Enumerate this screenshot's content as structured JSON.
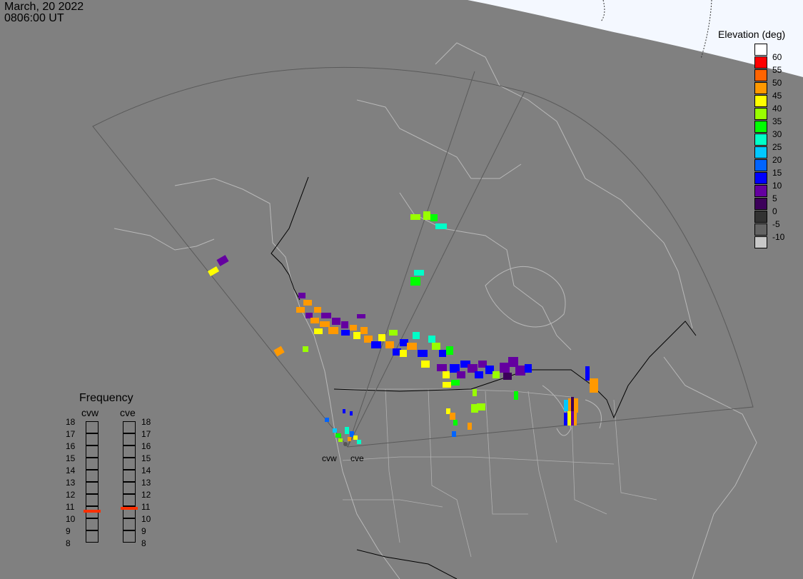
{
  "header": {
    "date": "March, 20 2022",
    "time": "0806:00 UT"
  },
  "legend": {
    "title": "Elevation (deg)",
    "entries": [
      {
        "label": "60",
        "color": "#ffffff"
      },
      {
        "label": "55",
        "color": "#ff0000"
      },
      {
        "label": "50",
        "color": "#ff6400"
      },
      {
        "label": "45",
        "color": "#ff9900"
      },
      {
        "label": "40",
        "color": "#ffff00"
      },
      {
        "label": "35",
        "color": "#99ff00"
      },
      {
        "label": "30",
        "color": "#00ff00"
      },
      {
        "label": "25",
        "color": "#00ffc8"
      },
      {
        "label": "20",
        "color": "#00c8ff"
      },
      {
        "label": "15",
        "color": "#0064ff"
      },
      {
        "label": "10",
        "color": "#0000ff"
      },
      {
        "label": "5",
        "color": "#6400a0"
      },
      {
        "label": "0",
        "color": "#3c005a"
      },
      {
        "label": "-5",
        "color": "#323232"
      },
      {
        "label": "-10",
        "color": "#646464"
      },
      {
        "label": "",
        "color": "#c8c8c8"
      }
    ]
  },
  "frequency": {
    "title": "Frequency",
    "radars": [
      "cvw",
      "cve"
    ],
    "scale": [
      "18",
      "17",
      "16",
      "15",
      "14",
      "13",
      "12",
      "11",
      "10",
      "9",
      "8"
    ],
    "values_mhz": [
      10.6,
      10.8
    ]
  },
  "radar_labels": [
    "cvw",
    "cve"
  ]
}
